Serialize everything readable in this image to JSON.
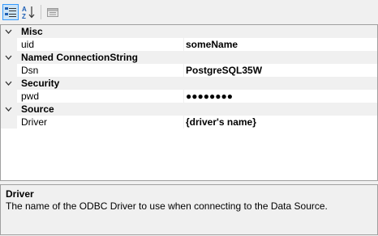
{
  "toolbar": {
    "categorized_icon": "categorized-icon",
    "alphabetical_icon": "alphabetical-icon",
    "property_pages_icon": "property-pages-icon"
  },
  "grid": {
    "categories": [
      {
        "label": "Misc",
        "expanded": true,
        "properties": [
          {
            "name": "uid",
            "value": "someName"
          }
        ]
      },
      {
        "label": "Named ConnectionString",
        "expanded": true,
        "properties": [
          {
            "name": "Dsn",
            "value": "PostgreSQL35W"
          }
        ]
      },
      {
        "label": "Security",
        "expanded": true,
        "properties": [
          {
            "name": "pwd",
            "value": "●●●●●●●●"
          }
        ]
      },
      {
        "label": "Source",
        "expanded": true,
        "properties": [
          {
            "name": "Driver",
            "value": "{driver's name}"
          }
        ]
      }
    ]
  },
  "help": {
    "title": "Driver",
    "description": "The name of the ODBC Driver to use when connecting to the Data Source."
  }
}
